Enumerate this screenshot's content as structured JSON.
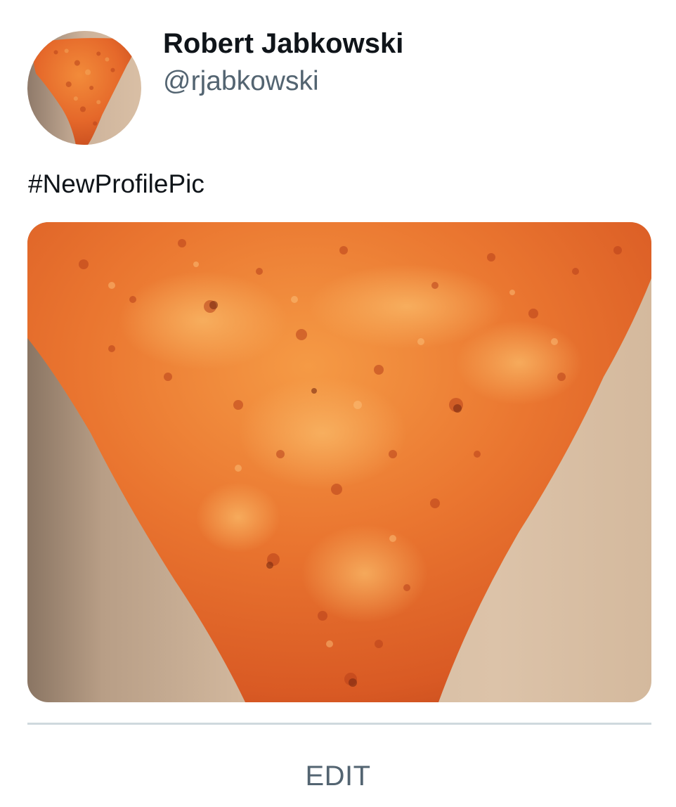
{
  "user": {
    "display_name": "Robert Jabkowski",
    "handle": "@rjabkowski"
  },
  "tweet": {
    "text": "#NewProfilePic"
  },
  "images": {
    "avatar_subject": "tortilla-chip",
    "media_subject": "tortilla-chip"
  },
  "actions": {
    "edit_label": "EDIT"
  },
  "colors": {
    "name_text": "#0f1419",
    "secondary_text": "#536471",
    "divider": "#cfd9de",
    "chip_orange": "#e8742a",
    "background_beige": "#c9a98a"
  }
}
